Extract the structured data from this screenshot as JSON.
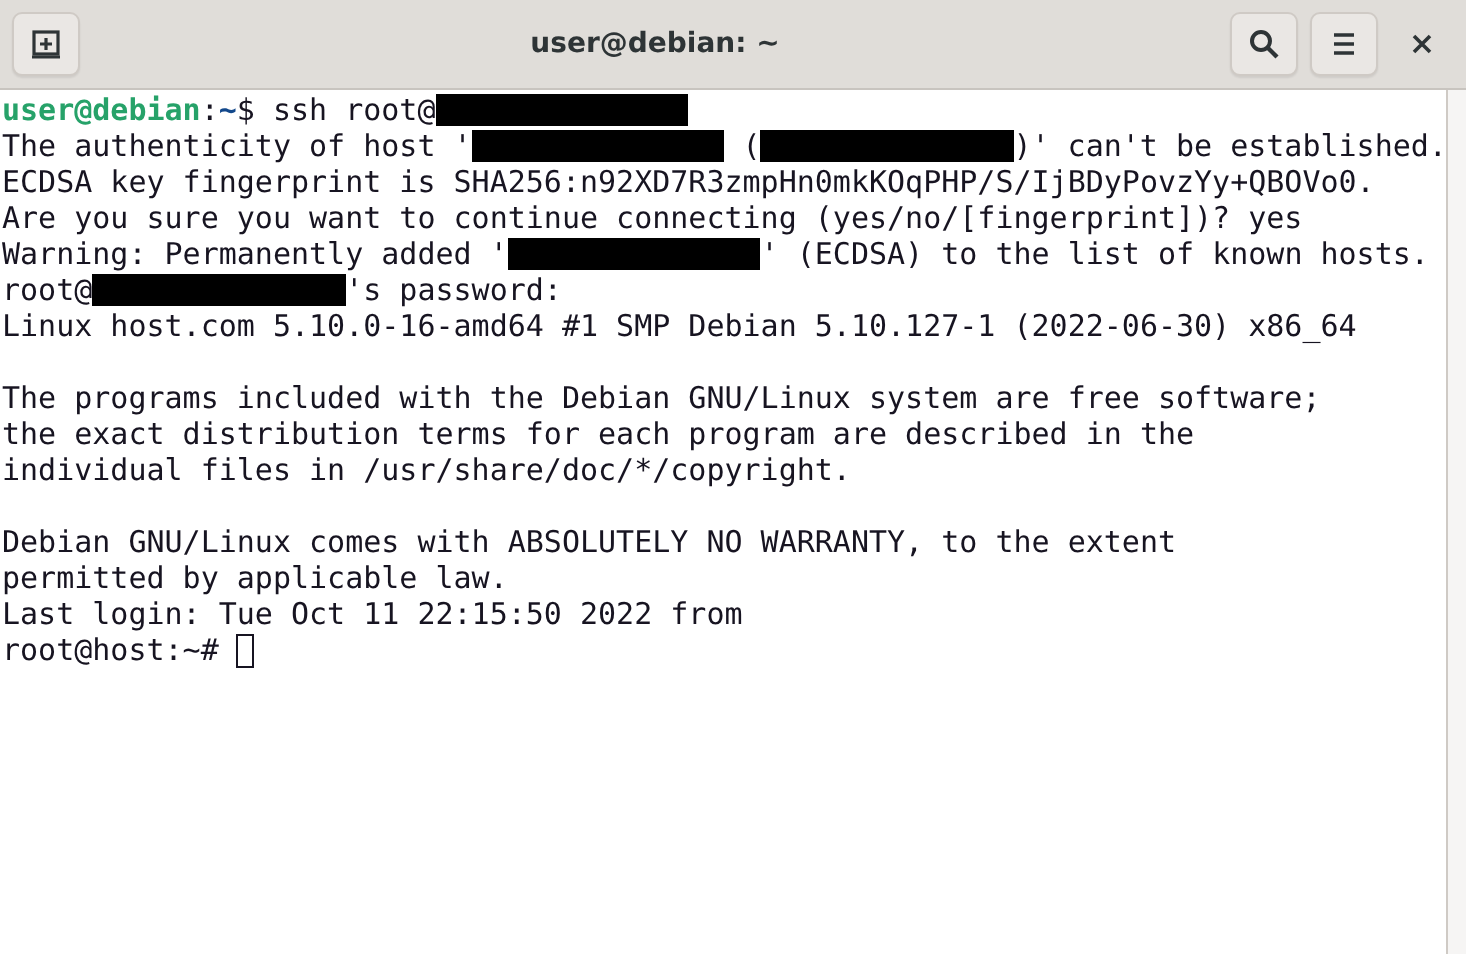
{
  "window": {
    "title": "user@debian: ~"
  },
  "header_buttons": [
    {
      "kind": "new-tab"
    },
    {
      "kind": "search"
    },
    {
      "kind": "menu"
    }
  ],
  "terminal": {
    "lines": [
      [
        {
          "kind": "user",
          "text": "user@debian"
        },
        {
          "kind": "text",
          "text": ":"
        },
        {
          "kind": "path",
          "text": "~"
        },
        {
          "kind": "text",
          "text": "$ ssh root@"
        },
        {
          "kind": "redacted"
        }
      ],
      [
        {
          "kind": "text",
          "text": "The authenticity of host '"
        },
        {
          "kind": "redacted"
        },
        {
          "kind": "text",
          "text": " ("
        },
        {
          "kind": "redacted"
        },
        {
          "kind": "text",
          "text": ")' can't be established."
        }
      ],
      [
        {
          "kind": "text",
          "text": "ECDSA key fingerprint is SHA256:n92XD7R3zmpHn0mkKOqPHP/S/IjBDyPovzYy+QBOVo0."
        }
      ],
      [
        {
          "kind": "text",
          "text": "Are you sure you want to continue connecting (yes/no/[fingerprint])? yes"
        }
      ],
      [
        {
          "kind": "text",
          "text": "Warning: Permanently added '"
        },
        {
          "kind": "redacted"
        },
        {
          "kind": "text",
          "text": "' (ECDSA) to the list of known hosts."
        }
      ],
      [
        {
          "kind": "text",
          "text": "root@"
        },
        {
          "kind": "redacted"
        },
        {
          "kind": "text",
          "text": "'s password:"
        }
      ],
      [
        {
          "kind": "text",
          "text": "Linux host.com 5.10.0-16-amd64 #1 SMP Debian 5.10.127-1 (2022-06-30) x86_64"
        }
      ],
      [
        {
          "kind": "blank"
        }
      ],
      [
        {
          "kind": "text",
          "text": "The programs included with the Debian GNU/Linux system are free software;"
        }
      ],
      [
        {
          "kind": "text",
          "text": "the exact distribution terms for each program are described in the"
        }
      ],
      [
        {
          "kind": "text",
          "text": "individual files in /usr/share/doc/*/copyright."
        }
      ],
      [
        {
          "kind": "blank"
        }
      ],
      [
        {
          "kind": "text",
          "text": "Debian GNU/Linux comes with ABSOLUTELY NO WARRANTY, to the extent"
        }
      ],
      [
        {
          "kind": "text",
          "text": "permitted by applicable law."
        }
      ],
      [
        {
          "kind": "text",
          "text": "Last login: Tue Oct 11 22:15:50 2022 from"
        }
      ],
      [
        {
          "kind": "text",
          "text": "root@host:~# "
        },
        {
          "kind": "cursor"
        }
      ]
    ]
  }
}
